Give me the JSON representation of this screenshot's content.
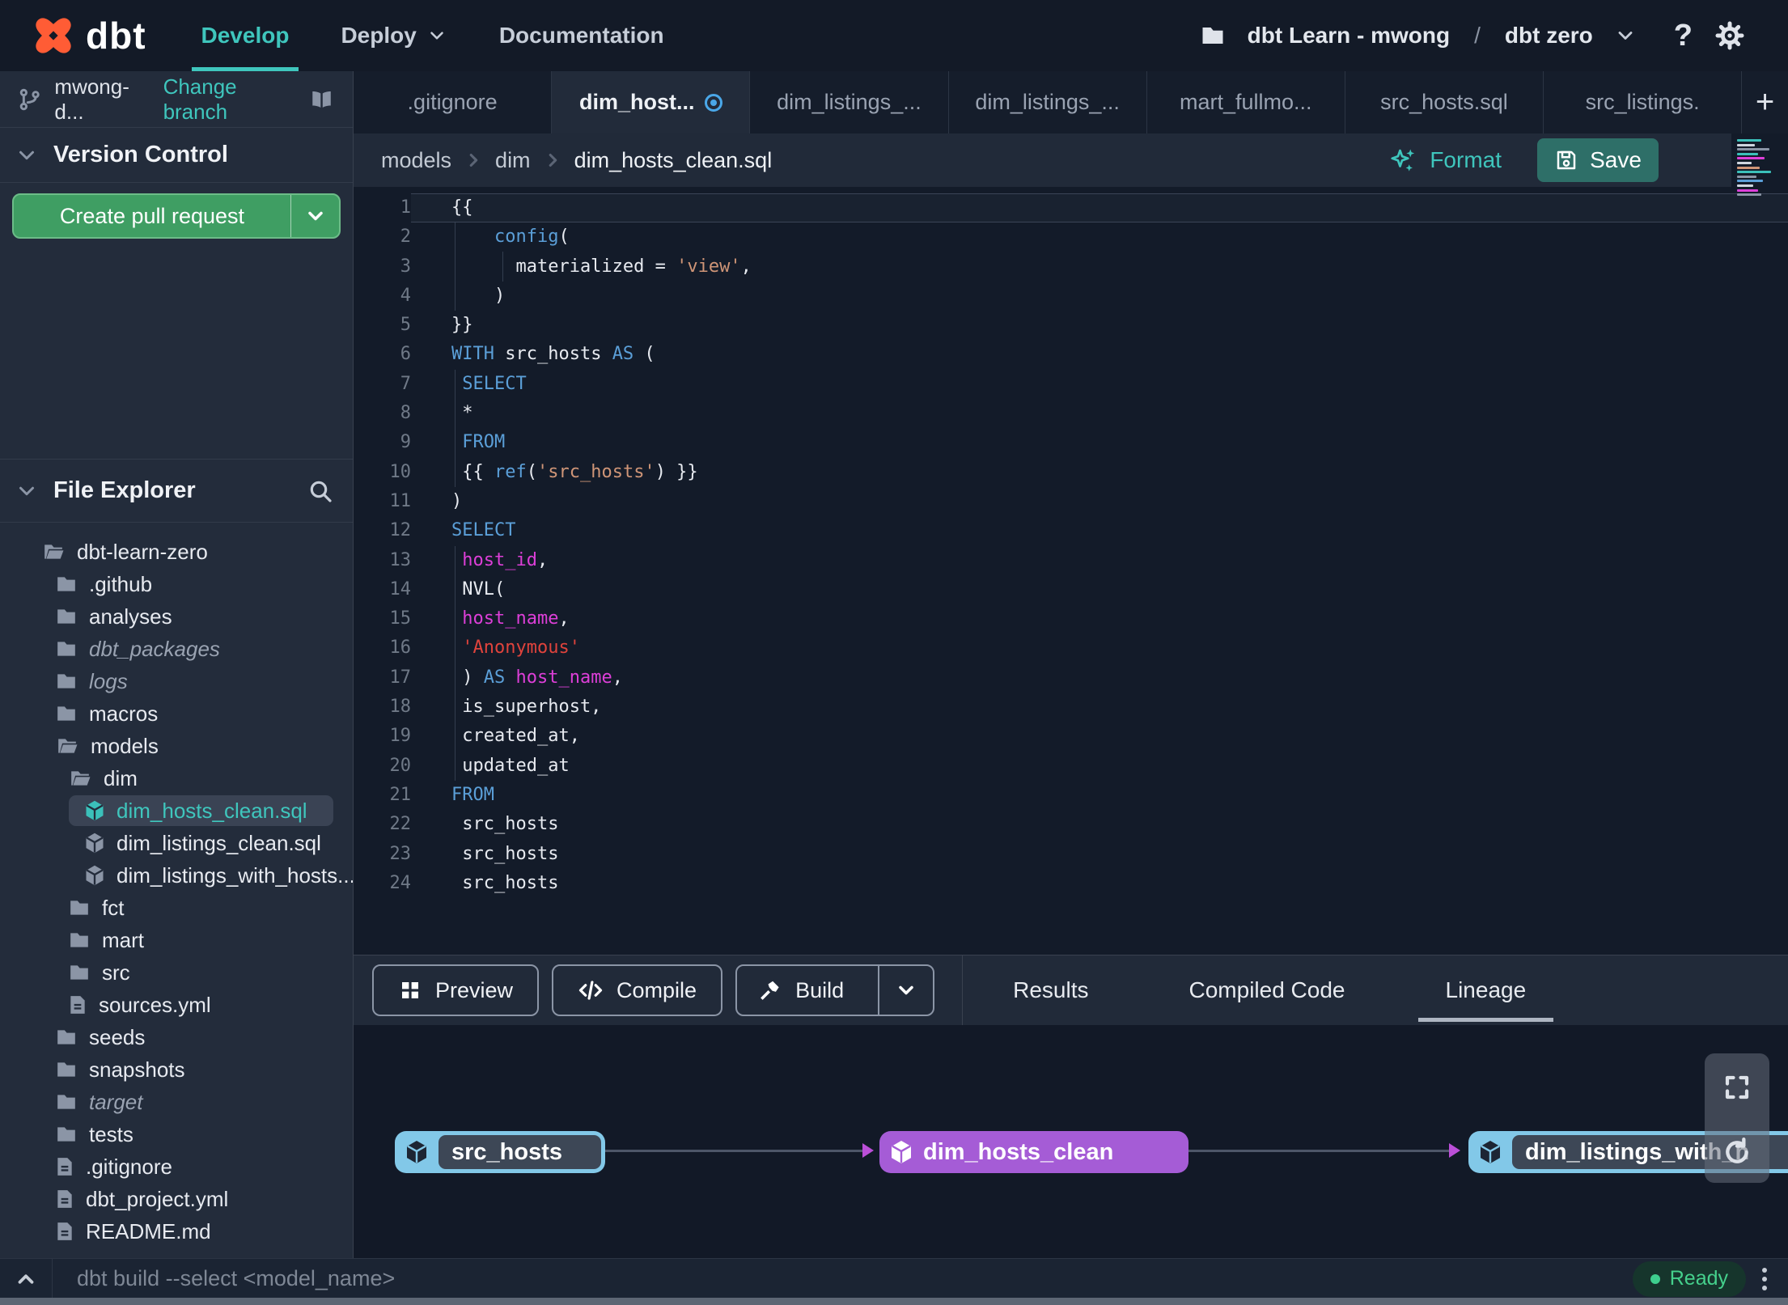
{
  "nav": {
    "brand": "dbt",
    "items": [
      {
        "label": "Develop",
        "active": true
      },
      {
        "label": "Deploy",
        "chevron": true
      },
      {
        "label": "Documentation"
      }
    ],
    "project": {
      "account": "dbt Learn - mwong",
      "separator": "/",
      "name": "dbt zero"
    },
    "icons": {
      "account": "folder-icon",
      "help": "question-icon",
      "settings": "gear-icon"
    }
  },
  "sidebar": {
    "branch": {
      "name": "mwong-d...",
      "action": "Change branch",
      "icons": [
        "git-branch-icon",
        "book-icon"
      ]
    },
    "version_control": {
      "title": "Version Control",
      "button_label": "Create pull request"
    },
    "file_explorer": {
      "title": "File Explorer",
      "icon": "search-icon",
      "tree": [
        {
          "label": "dbt-learn-zero",
          "depth": 0,
          "icon": "folder-open"
        },
        {
          "label": ".github",
          "depth": 1,
          "icon": "folder"
        },
        {
          "label": "analyses",
          "depth": 1,
          "icon": "folder"
        },
        {
          "label": "dbt_packages",
          "depth": 1,
          "icon": "folder",
          "italic": true
        },
        {
          "label": "logs",
          "depth": 1,
          "icon": "folder",
          "italic": true
        },
        {
          "label": "macros",
          "depth": 1,
          "icon": "folder"
        },
        {
          "label": "models",
          "depth": 1,
          "icon": "folder-open"
        },
        {
          "label": "dim",
          "depth": 2,
          "icon": "folder-open"
        },
        {
          "label": "dim_hosts_clean.sql",
          "depth": 3,
          "icon": "cube",
          "selected": true,
          "dot": true
        },
        {
          "label": "dim_listings_clean.sql",
          "depth": 3,
          "icon": "cube"
        },
        {
          "label": "dim_listings_with_hosts...",
          "depth": 3,
          "icon": "cube"
        },
        {
          "label": "fct",
          "depth": 2,
          "icon": "folder"
        },
        {
          "label": "mart",
          "depth": 2,
          "icon": "folder"
        },
        {
          "label": "src",
          "depth": 2,
          "icon": "folder"
        },
        {
          "label": "sources.yml",
          "depth": 2,
          "icon": "file"
        },
        {
          "label": "seeds",
          "depth": 1,
          "icon": "folder"
        },
        {
          "label": "snapshots",
          "depth": 1,
          "icon": "folder"
        },
        {
          "label": "target",
          "depth": 1,
          "icon": "folder",
          "italic": true
        },
        {
          "label": "tests",
          "depth": 1,
          "icon": "folder"
        },
        {
          "label": ".gitignore",
          "depth": 1,
          "icon": "file"
        },
        {
          "label": "dbt_project.yml",
          "depth": 1,
          "icon": "file"
        },
        {
          "label": "README.md",
          "depth": 1,
          "icon": "file"
        }
      ]
    }
  },
  "tabs": {
    "items": [
      {
        "label": ".gitignore"
      },
      {
        "label": "dim_host...",
        "active": true,
        "modified": true
      },
      {
        "label": "dim_listings_..."
      },
      {
        "label": "dim_listings_..."
      },
      {
        "label": "mart_fullmo..."
      },
      {
        "label": "src_hosts.sql"
      },
      {
        "label": "src_listings."
      }
    ],
    "new_tab_label": "+"
  },
  "breadcrumb": {
    "segments": [
      "models",
      "dim",
      "dim_hosts_clean.sql"
    ],
    "format_label": "Format",
    "save_label": "Save"
  },
  "editor": {
    "lines": [
      [
        [
          "p",
          "{{"
        ]
      ],
      [
        [
          "p",
          "    "
        ],
        [
          "k",
          "config"
        ],
        [
          "p",
          "("
        ]
      ],
      [
        [
          "p",
          "      materialized = "
        ],
        [
          "s",
          "'view'"
        ],
        [
          "p",
          ","
        ]
      ],
      [
        [
          "p",
          "    )"
        ]
      ],
      [
        [
          "p",
          "}}"
        ]
      ],
      [
        [
          "k",
          "WITH"
        ],
        [
          "p",
          " src_hosts "
        ],
        [
          "k",
          "AS"
        ],
        [
          "p",
          " ("
        ]
      ],
      [
        [
          "p",
          " "
        ],
        [
          "k",
          "SELECT"
        ]
      ],
      [
        [
          "p",
          " *"
        ]
      ],
      [
        [
          "p",
          " "
        ],
        [
          "k",
          "FROM"
        ]
      ],
      [
        [
          "p",
          " {{ "
        ],
        [
          "k",
          "ref"
        ],
        [
          "p",
          "("
        ],
        [
          "s",
          "'src_hosts'"
        ],
        [
          "p",
          ") }}"
        ]
      ],
      [
        [
          "p",
          ")"
        ]
      ],
      [
        [
          "k",
          "SELECT"
        ]
      ],
      [
        [
          "p",
          " "
        ],
        [
          "m",
          "host_id"
        ],
        [
          "p",
          ","
        ]
      ],
      [
        [
          "p",
          " NVL("
        ]
      ],
      [
        [
          "p",
          " "
        ],
        [
          "m",
          "host_name"
        ],
        [
          "p",
          ","
        ]
      ],
      [
        [
          "p",
          " "
        ],
        [
          "r",
          "'Anonymous'"
        ]
      ],
      [
        [
          "p",
          " ) "
        ],
        [
          "k",
          "AS"
        ],
        [
          "p",
          " "
        ],
        [
          "m",
          "host_name"
        ],
        [
          "p",
          ","
        ]
      ],
      [
        [
          "p",
          " is_superhost,"
        ]
      ],
      [
        [
          "p",
          " created_at,"
        ]
      ],
      [
        [
          "p",
          " updated_at"
        ]
      ],
      [
        [
          "k",
          "FROM"
        ]
      ],
      [
        [
          "p",
          " src_hosts"
        ]
      ],
      [
        [
          "p",
          " src_hosts"
        ]
      ],
      [
        [
          "p",
          " src_hosts"
        ]
      ]
    ]
  },
  "bottom_panel": {
    "buttons": [
      {
        "label": "Preview",
        "icon": "grid-icon"
      },
      {
        "label": "Compile",
        "icon": "code-icon"
      },
      {
        "label": "Build",
        "icon": "hammer-icon",
        "split": true
      }
    ],
    "tabs": [
      {
        "label": "Results"
      },
      {
        "label": "Compiled Code"
      },
      {
        "label": "Lineage",
        "active": true
      }
    ]
  },
  "lineage": {
    "nodes": [
      {
        "label": "src_hosts",
        "style": "blue"
      },
      {
        "label": "dim_hosts_clean",
        "style": "purple"
      },
      {
        "label": "dim_listings_with_h",
        "style": "blue",
        "clipped": true
      }
    ],
    "controls": [
      "fullscreen-icon",
      "refresh-icon"
    ]
  },
  "status_bar": {
    "command": "dbt build --select <model_name>",
    "status": "Ready"
  },
  "colors": {
    "accent_teal": "#3fc6bd",
    "green_button": "#3f9e63",
    "save_button": "#2e6f68",
    "node_blue": "#82c8e8",
    "node_purple": "#a55cd6",
    "keyword": "#5b9fd8",
    "string": "#cf9577",
    "error_string": "#e0433c",
    "column": "#dd3fd8",
    "ready_green": "#3ecf8e"
  }
}
